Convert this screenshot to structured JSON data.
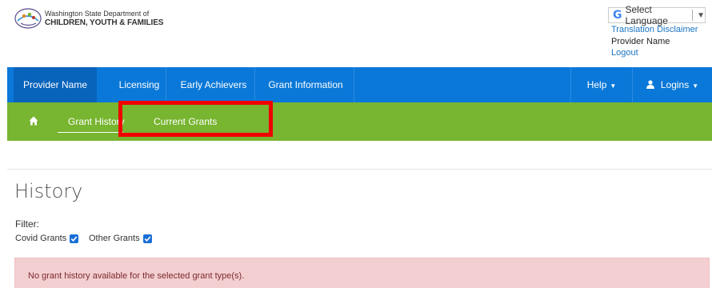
{
  "header": {
    "logo_line1": "Washington State Department of",
    "logo_line2": "CHILDREN, YOUTH & FAMILIES",
    "language_select": "Select Language",
    "translation_disclaimer": "Translation Disclaimer",
    "provider_name": "Provider Name",
    "logout": "Logout"
  },
  "nav": {
    "items": [
      {
        "label": "Provider Name",
        "active": true
      },
      {
        "label": "Licensing"
      },
      {
        "label": "Early Achievers"
      },
      {
        "label": "Grant Information"
      }
    ],
    "help": "Help",
    "logins": "Logins"
  },
  "subnav": {
    "grant_history": "Grant History",
    "current_grants": "Current Grants"
  },
  "page": {
    "title": "History",
    "filter_label": "Filter:",
    "filters": [
      {
        "label": "Covid Grants",
        "checked": true
      },
      {
        "label": "Other Grants",
        "checked": true
      }
    ],
    "alert": "No grant history available for the selected grant type(s)."
  },
  "colors": {
    "nav_blue": "#0a78d8",
    "nav_green": "#78b530",
    "highlight": "#f00000",
    "alert_bg": "#f4cfd2"
  }
}
